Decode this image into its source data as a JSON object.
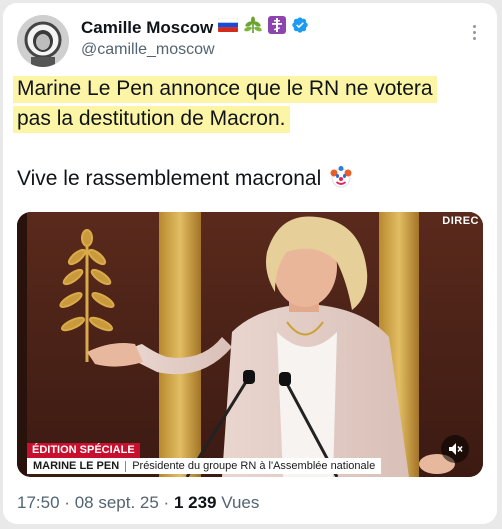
{
  "tweet": {
    "author": {
      "display_name": "Camille Moscow",
      "handle": "@camille_moscow",
      "badges": [
        "russia-flag-icon",
        "herb-icon",
        "orthodox-cross-icon",
        "verified-icon"
      ]
    },
    "text_lines": [
      "Marine Le Pen annonce que le RN ne votera",
      "pas la destitution de Macron.",
      "Vive le rassemblement macronal"
    ],
    "emoji": "clown-face-icon",
    "highlight_color": "#fdf5a6",
    "media": {
      "live_tag": "DIREC",
      "banner_red": "ÉDITION SPÉCIALE",
      "banner_name": "MARINE LE PEN",
      "banner_caption": "Présidente du groupe RN à l'Assemblée nationale"
    },
    "meta": {
      "time": "17:50",
      "dot1": "·",
      "date": "08 sept. 25",
      "dot2": "·",
      "views_count": "1 239",
      "views_label": "Vues"
    }
  },
  "colors": {
    "text": "#0f1419",
    "secondary": "#536471",
    "verified": "#1d9bf0",
    "banner_red": "#c8102e"
  }
}
